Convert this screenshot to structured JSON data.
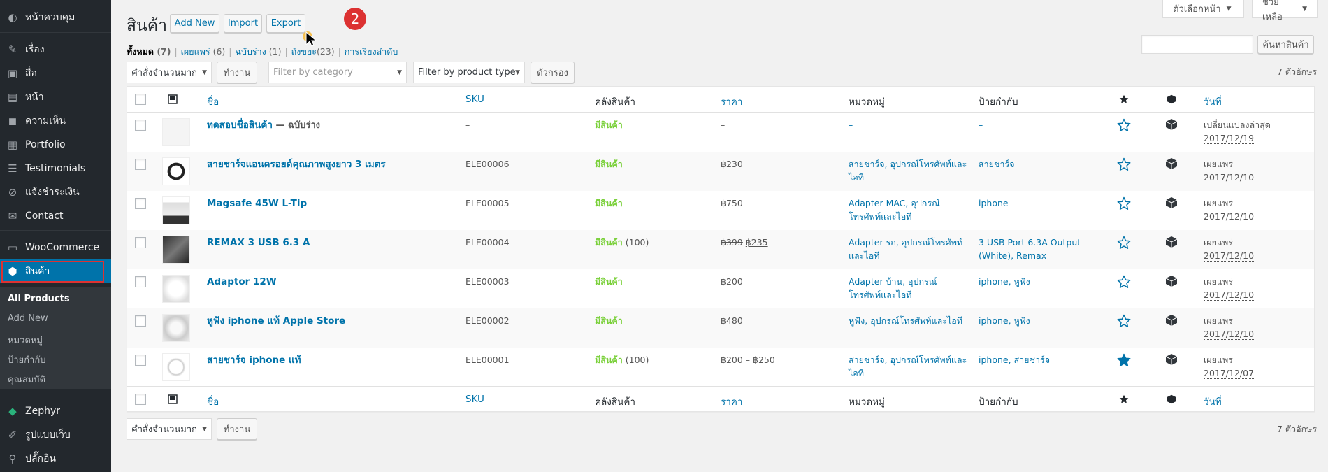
{
  "sidebar": {
    "items": [
      {
        "label": "หน้าควบคุม",
        "icon": "dashboard-icon"
      },
      {
        "label": "เรื่อง",
        "icon": "pin-icon"
      },
      {
        "label": "สื่อ",
        "icon": "media-icon"
      },
      {
        "label": "หน้า",
        "icon": "pages-icon"
      },
      {
        "label": "ความเห็น",
        "icon": "comment-icon"
      },
      {
        "label": "Portfolio",
        "icon": "portfolio-icon"
      },
      {
        "label": "Testimonials",
        "icon": "testimonials-icon"
      },
      {
        "label": "แจ้งชำระเงิน",
        "icon": "link-icon"
      },
      {
        "label": "Contact",
        "icon": "mail-icon"
      },
      {
        "label": "WooCommerce",
        "icon": "woo-icon"
      },
      {
        "label": "สินค้า",
        "icon": "product-icon"
      },
      {
        "label": "Zephyr",
        "icon": "diamond-icon"
      },
      {
        "label": "รูปแบบเว็บ",
        "icon": "brush-icon"
      },
      {
        "label": "ปลั๊กอิน",
        "icon": "plugin-icon"
      }
    ],
    "submenu": [
      "All Products",
      "Add New",
      "หมวดหมู่",
      "ป้ายกำกับ",
      "คุณสมบัติ"
    ]
  },
  "header": {
    "title": "สินค้า",
    "add_new": "Add New",
    "import": "Import",
    "export": "Export",
    "badge": "2",
    "screen_options": "ตัวเลือกหน้า",
    "help": "ช่วยเหลือ"
  },
  "views": [
    {
      "label": "ทั้งหมด",
      "count": "(7)"
    },
    {
      "label": "เผยแพร่",
      "count": "(6)"
    },
    {
      "label": "ฉบับร่าง",
      "count": "(1)"
    },
    {
      "label": "ถังขยะ",
      "count": "(23)"
    },
    {
      "label": "การเรียงลำดับ",
      "count": ""
    }
  ],
  "search": {
    "button": "ค้นหาสินค้า"
  },
  "filters": {
    "bulk_action": "คำสั่งจำนวนมาก",
    "apply": "ทำงาน",
    "category_placeholder": "Filter by category",
    "product_type": "Filter by product type",
    "filter_button": "ตัวกรอง",
    "items_count": "7 ตัวอักษร"
  },
  "columns": {
    "name": "ชื่อ",
    "sku": "SKU",
    "stock": "คลังสินค้า",
    "price": "ราคา",
    "categories": "หมวดหมู่",
    "tags": "ป้ายกำกับ",
    "date": "วันที่"
  },
  "rows": [
    {
      "name": "ทดสอบชื่อสินค้า",
      "suffix": " — ฉบับร่าง",
      "sku": "–",
      "stock": "มีสินค้า",
      "stock_qty": "",
      "price": "–",
      "price_old": "",
      "categories": [
        "–"
      ],
      "tags": [
        "–"
      ],
      "featured": false,
      "status": "เปลี่ยนแปลงล่าสุด",
      "date": "2017/12/19",
      "thumb": "placeholder"
    },
    {
      "name": "สายชาร์จแอนดรอยด์คุณภาพสูงยาว 3 เมตร",
      "suffix": "",
      "sku": "ELE00006",
      "stock": "มีสินค้า",
      "stock_qty": "",
      "price": "฿230",
      "price_old": "",
      "categories": [
        "สายชาร์จ, อุปกรณ์โทรศัพท์และ",
        "ไอที"
      ],
      "tags": [
        "สายชาร์จ"
      ],
      "featured": false,
      "status": "เผยแพร่",
      "date": "2017/12/10",
      "thumb": "cable"
    },
    {
      "name": "Magsafe 45W L-Tip",
      "suffix": "",
      "sku": "ELE00005",
      "stock": "มีสินค้า",
      "stock_qty": "",
      "price": "฿750",
      "price_old": "",
      "categories": [
        "Adapter MAC, อุปกรณ์",
        "โทรศัพท์และไอที"
      ],
      "tags": [
        "iphone"
      ],
      "featured": false,
      "status": "เผยแพร่",
      "date": "2017/12/10",
      "thumb": "adapter"
    },
    {
      "name": "REMAX 3 USB 6.3 A",
      "suffix": "",
      "sku": "ELE00004",
      "stock": "มีสินค้า",
      "stock_qty": " (100)",
      "price": "฿235",
      "price_old": "฿399",
      "categories": [
        "Adapter รถ, อุปกรณ์โทรศัพท์",
        "และไอที"
      ],
      "tags": [
        "3 USB Port 6.3A Output",
        "(White), Remax"
      ],
      "featured": false,
      "status": "เผยแพร่",
      "date": "2017/12/10",
      "thumb": "car"
    },
    {
      "name": "Adaptor 12W",
      "suffix": "",
      "sku": "ELE00003",
      "stock": "มีสินค้า",
      "stock_qty": "",
      "price": "฿200",
      "price_old": "",
      "categories": [
        "Adapter บ้าน, อุปกรณ์",
        "โทรศัพท์และไอที"
      ],
      "tags": [
        "iphone, หูฟัง"
      ],
      "featured": false,
      "status": "เผยแพร่",
      "date": "2017/12/10",
      "thumb": "white"
    },
    {
      "name": "หูฟัง iphone แท้ Apple Store",
      "suffix": "",
      "sku": "ELE00002",
      "stock": "มีสินค้า",
      "stock_qty": "",
      "price": "฿480",
      "price_old": "",
      "categories": [
        "หูฟัง, อุปกรณ์โทรศัพท์และไอที"
      ],
      "tags": [
        "iphone, หูฟัง"
      ],
      "featured": false,
      "status": "เผยแพร่",
      "date": "2017/12/10",
      "thumb": "earphone"
    },
    {
      "name": "สายชาร์จ iphone แท้",
      "suffix": "",
      "sku": "ELE00001",
      "stock": "มีสินค้า",
      "stock_qty": " (100)",
      "price": "฿200 – ฿250",
      "price_old": "",
      "categories": [
        "สายชาร์จ, อุปกรณ์โทรศัพท์และ",
        "ไอที"
      ],
      "tags": [
        "iphone, สายชาร์จ"
      ],
      "featured": true,
      "status": "เผยแพร่",
      "date": "2017/12/07",
      "thumb": "cablewhite"
    }
  ],
  "colors": {
    "accent": "#0073aa",
    "instock": "#7ad03a",
    "badge": "#dc3232",
    "sidebar": "#23282d"
  }
}
